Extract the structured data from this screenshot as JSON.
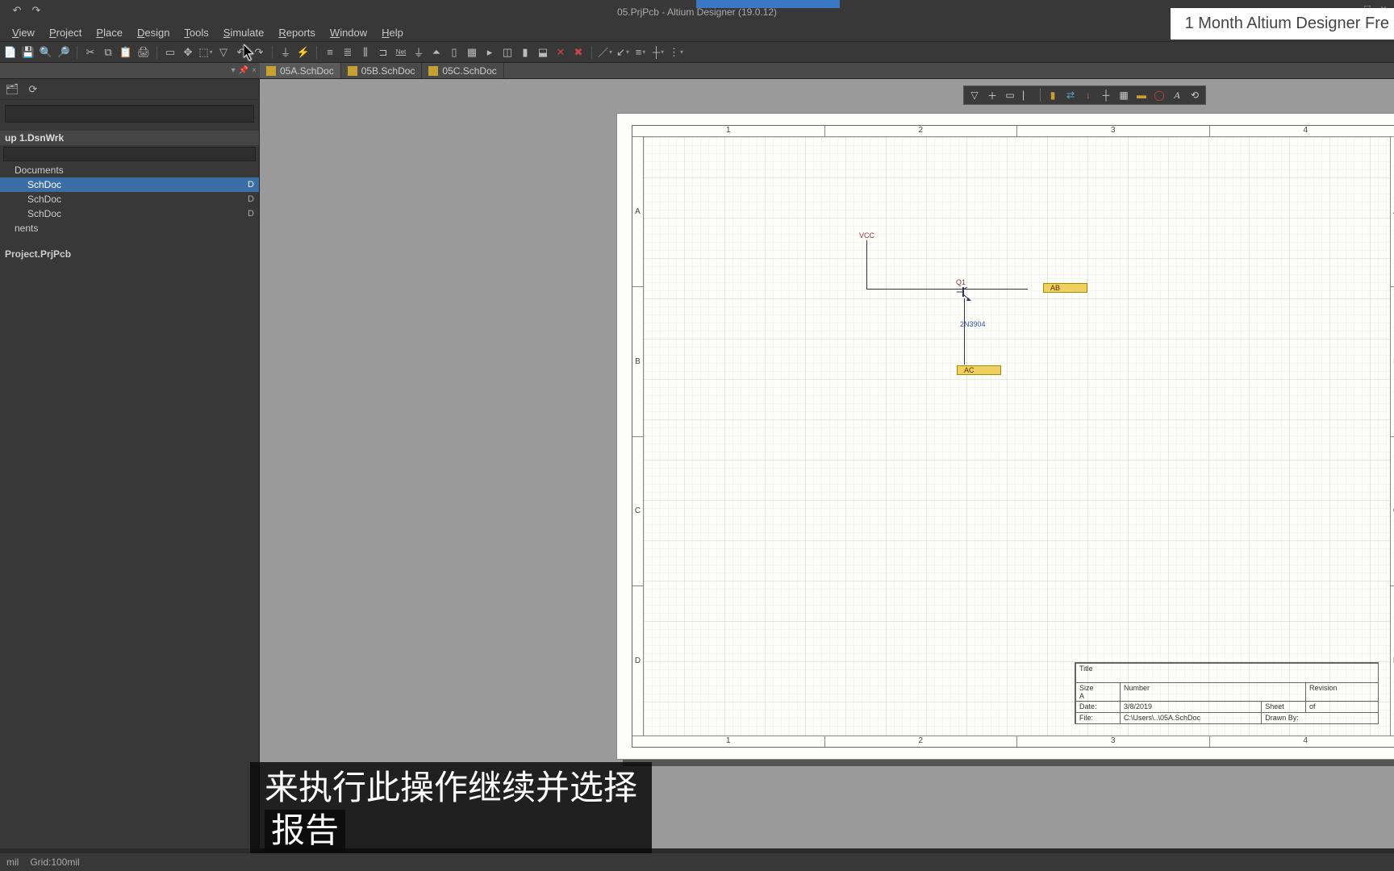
{
  "title": "05.PrjPcb - Altium Designer (19.0.12)",
  "trial_banner": "1 Month Altium Designer Fre",
  "menu": [
    "View",
    "Project",
    "Place",
    "Design",
    "Tools",
    "Simulate",
    "Reports",
    "Window",
    "Help"
  ],
  "tabs": [
    {
      "label": "05A.SchDoc",
      "active": true
    },
    {
      "label": "05B.SchDoc",
      "active": false
    },
    {
      "label": "05C.SchDoc",
      "active": false
    }
  ],
  "panel_ctl": [
    "▾",
    "📌",
    "×"
  ],
  "tree": {
    "group": "up 1.DsnWrk",
    "filter": "",
    "nodes": [
      {
        "label": "Documents",
        "lvl": 1
      },
      {
        "label": "SchDoc",
        "lvl": 2,
        "sel": true,
        "tail": "D"
      },
      {
        "label": "SchDoc",
        "lvl": 2,
        "tail": "D"
      },
      {
        "label": "SchDoc",
        "lvl": 2,
        "tail": "D"
      },
      {
        "label": "nents",
        "lvl": 1
      }
    ],
    "project": "Project.PrjPcb"
  },
  "cols": [
    "1",
    "2",
    "3",
    "4"
  ],
  "rows": [
    "A",
    "B",
    "C",
    "D"
  ],
  "schematic": {
    "vcc": "VCC",
    "q1": "Q1",
    "part": "2N3904",
    "net_ab": "AB",
    "net_ac": "AC"
  },
  "title_block": {
    "title_lbl": "Title",
    "size_lbl": "Size",
    "size_val": "A",
    "num_lbl": "Number",
    "rev_lbl": "Revision",
    "date_lbl": "Date:",
    "date_val": "3/8/2019",
    "file_lbl": "File:",
    "file_val": "C:\\Users\\..\\05A.SchDoc",
    "sheet_lbl": "Sheet",
    "sheet_of": "of",
    "drawn_lbl": "Drawn By:"
  },
  "status": {
    "left": "mil",
    "grid": "Grid:100mil"
  },
  "subtitles": [
    "来执行此操作继续并选择",
    "报告"
  ]
}
